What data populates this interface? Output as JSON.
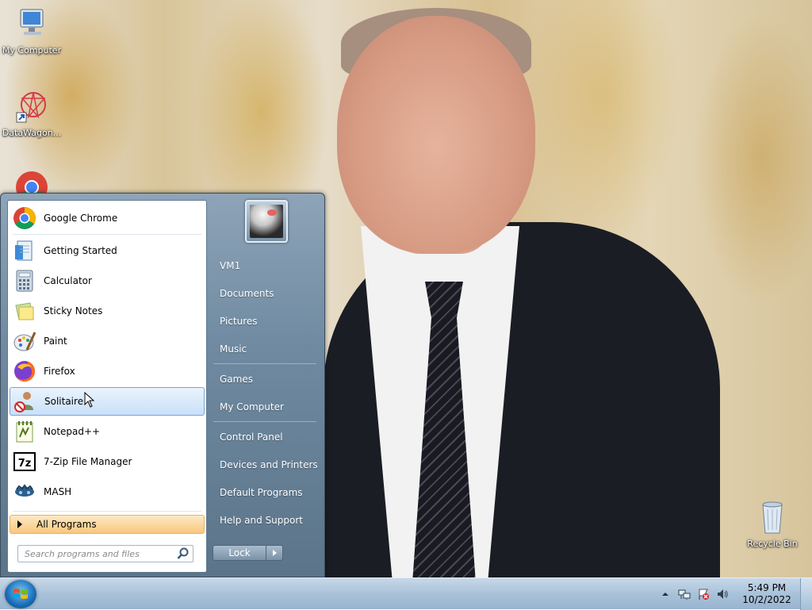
{
  "desktop": {
    "icons": [
      {
        "label": "My Computer"
      },
      {
        "label": "DataWagon..."
      },
      {
        "label": "Recycle Bin"
      }
    ]
  },
  "start_menu": {
    "programs": [
      {
        "label": "Google Chrome",
        "icon": "chrome-icon"
      },
      {
        "label": "Getting Started",
        "icon": "getting-started-icon"
      },
      {
        "label": "Calculator",
        "icon": "calculator-icon"
      },
      {
        "label": "Sticky Notes",
        "icon": "sticky-notes-icon"
      },
      {
        "label": "Paint",
        "icon": "paint-icon"
      },
      {
        "label": "Firefox",
        "icon": "firefox-icon"
      },
      {
        "label": "Solitaire",
        "icon": "solitaire-icon"
      },
      {
        "label": "Notepad++",
        "icon": "notepadpp-icon"
      },
      {
        "label": "7-Zip File Manager",
        "icon": "7zip-icon"
      },
      {
        "label": "MASH",
        "icon": "mash-icon"
      }
    ],
    "all_programs": "All Programs",
    "search_placeholder": "Search programs and files",
    "right_items": [
      {
        "label": "VM1"
      },
      {
        "label": "Documents"
      },
      {
        "label": "Pictures"
      },
      {
        "label": "Music"
      },
      {
        "label": "Games"
      },
      {
        "label": "My Computer"
      },
      {
        "label": "Control Panel"
      },
      {
        "label": "Devices and Printers"
      },
      {
        "label": "Default Programs"
      },
      {
        "label": "Help and Support"
      }
    ],
    "lock_label": "Lock"
  },
  "taskbar": {
    "time": "5:49 PM",
    "date": "10/2/2022"
  },
  "colors": {
    "hover_highlight": "#c9e0f8",
    "all_programs_bg": "#f9c77d",
    "start_menu_frame": "#6f8aa1"
  }
}
